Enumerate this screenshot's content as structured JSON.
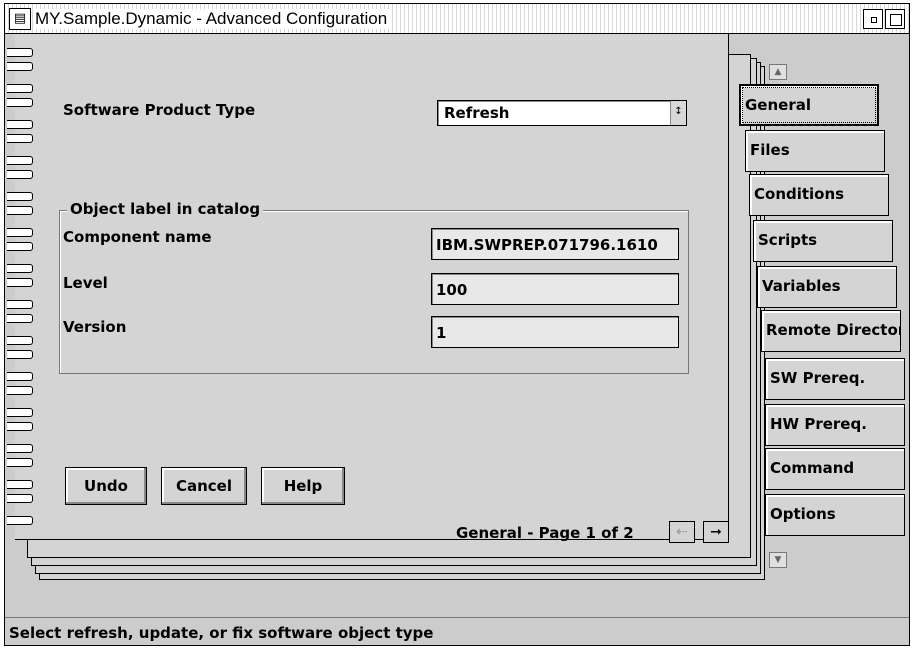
{
  "window": {
    "title": "MY.Sample.Dynamic - Advanced Configuration",
    "system_menu_icon": "system-menu-icon",
    "minimize_icon": "minimize-icon",
    "maximize_icon": "maximize-icon"
  },
  "form": {
    "product_type_label": "Software Product Type",
    "product_type_value": "Refresh",
    "group_title": "Object label in catalog",
    "component_name_label": "Component name",
    "component_name_value": "IBM.SWPREP.071796.1610",
    "level_label": "Level",
    "level_value": "100",
    "version_label": "Version",
    "version_value": "1"
  },
  "buttons": {
    "undo": "Undo",
    "cancel": "Cancel",
    "help": "Help"
  },
  "pager": {
    "text": "General - Page 1 of 2",
    "prev_icon": "arrow-left-icon",
    "next_icon": "arrow-right-icon"
  },
  "tabs": [
    {
      "label": "General",
      "mnemonic": "G",
      "active": true
    },
    {
      "label": "Files",
      "mnemonic": "F",
      "active": false
    },
    {
      "label": "Conditions",
      "mnemonic": "C",
      "active": false
    },
    {
      "label": "Scripts",
      "mnemonic": "S",
      "active": false
    },
    {
      "label": "Variables",
      "mnemonic": "V",
      "active": false
    },
    {
      "label": "Remote Directory",
      "mnemonic": "R",
      "active": false
    },
    {
      "label": "SW Prereq.",
      "mnemonic": "W",
      "active": false
    },
    {
      "label": "HW Prereq.",
      "mnemonic": "H",
      "active": false
    },
    {
      "label": "Command",
      "mnemonic": "C",
      "active": false
    },
    {
      "label": "Options",
      "mnemonic": "O",
      "active": false
    }
  ],
  "status": {
    "text": "Select refresh, update, or fix software object type"
  }
}
